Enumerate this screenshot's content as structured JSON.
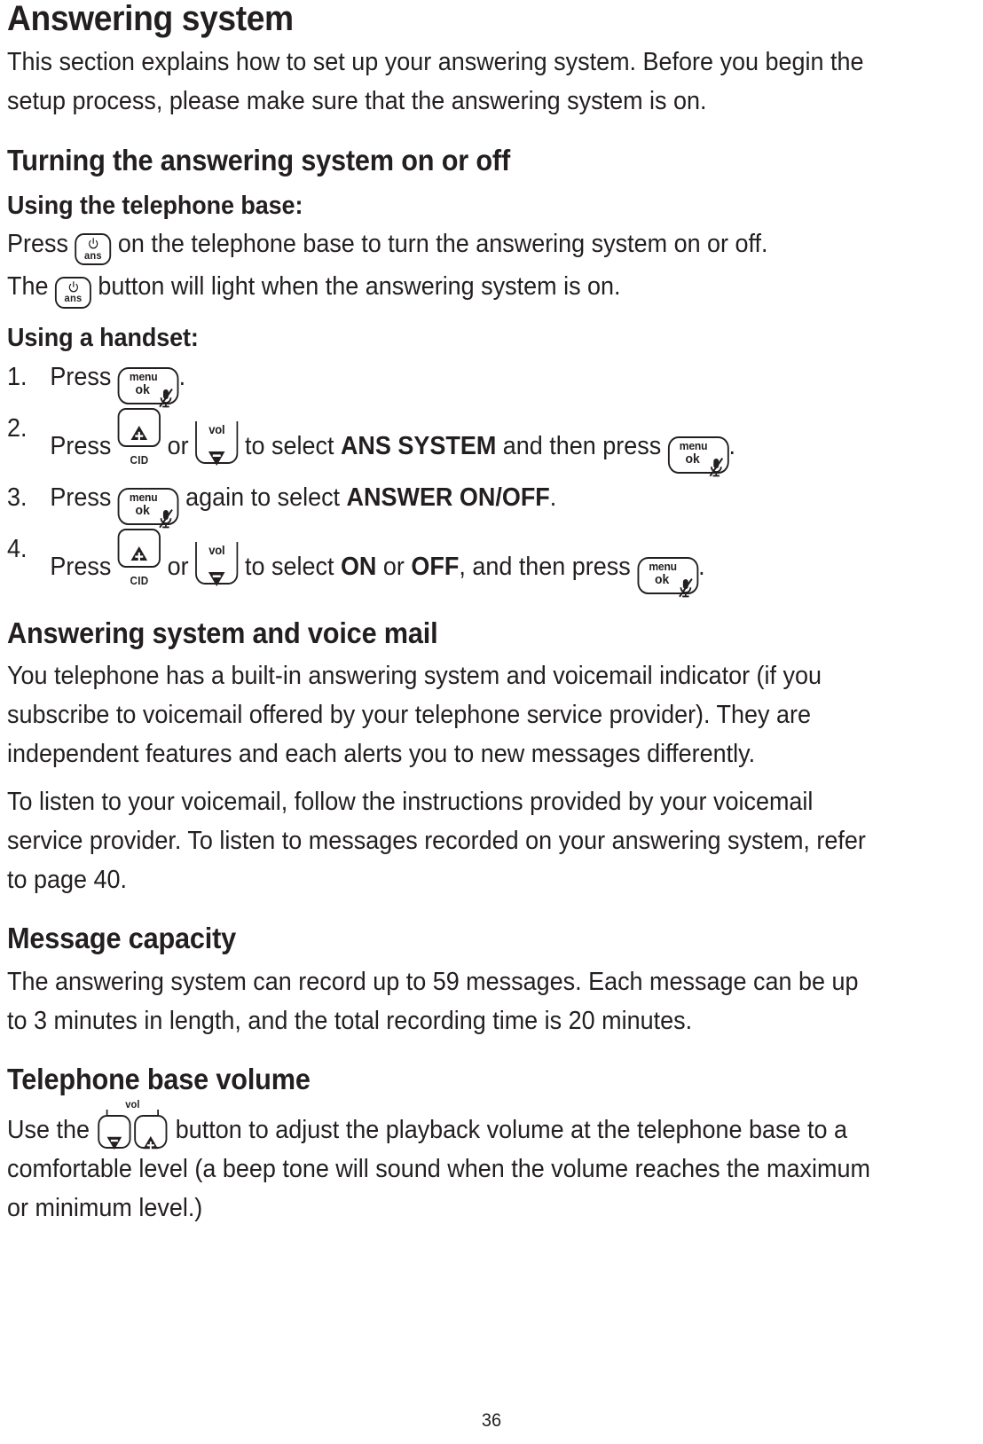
{
  "document": {
    "page_number": "36",
    "text_color": "#231f20",
    "background_color": "#ffffff"
  },
  "title": "Answering system",
  "intro": "This section explains how to set up your answering system. Before you begin the setup process, please make sure that the answering system is on.",
  "sections": [
    {
      "heading": "Turning the answering system on or off",
      "sub_heading_base": "Using the telephone base:",
      "base_text_1a": "Press",
      "base_text_1b": "on the telephone base to turn the answering system on or off.",
      "base_text_2a": "The",
      "base_text_2b": "button will light when the answering system is on.",
      "sub_heading_handset": "Using a handset:",
      "steps": [
        {
          "num": "1.",
          "parts": [
            "Press",
            "."
          ]
        },
        {
          "num": "2.",
          "parts": [
            "Press",
            "or",
            "to select",
            "ANS SYSTEM",
            "and then press",
            "."
          ]
        },
        {
          "num": "3.",
          "parts": [
            "Press",
            "again to select",
            "ANSWER ON/OFF",
            "."
          ]
        },
        {
          "num": "4.",
          "parts": [
            "Press",
            "or",
            "to select",
            "ON",
            "or",
            "OFF",
            ", and then press",
            "."
          ]
        }
      ]
    },
    {
      "heading": "Answering system and voice mail",
      "paragraphs": [
        "You telephone has a built-in answering system and voicemail indicator (if you subscribe to voicemail offered by your telephone service provider). They are independent features and each alerts you to new messages differently.",
        "To listen to your voicemail, follow the instructions provided by your voicemail service provider. To listen to messages recorded on your answering system, refer to page 40."
      ]
    },
    {
      "heading": "Message capacity",
      "paragraphs": [
        "The answering system can record up to 59 messages. Each message can be up to 3 minutes in length, and the total recording time is 20 minutes."
      ]
    },
    {
      "heading": "Telephone base volume",
      "volume_text_a": "Use the",
      "volume_text_b": "button to adjust the playback volume at the telephone base to a comfortable level (a beep tone will sound when the volume reaches the maximum or minimum level.)"
    }
  ],
  "keys": {
    "ans": {
      "power_symbol": "⏻",
      "label": "ans"
    },
    "menu_ok": {
      "line1": "menu",
      "line2": "ok",
      "icon": "mute-microphone-icon"
    },
    "cid_up": {
      "label": "CID",
      "icon": "up-triangle-plus-icon"
    },
    "vol_down": {
      "label": "vol",
      "icon": "down-triangle-minus-icon"
    },
    "base_volume": {
      "label": "vol",
      "icon_left": "down-triangle-minus-icon",
      "icon_right": "up-triangle-plus-icon"
    }
  }
}
